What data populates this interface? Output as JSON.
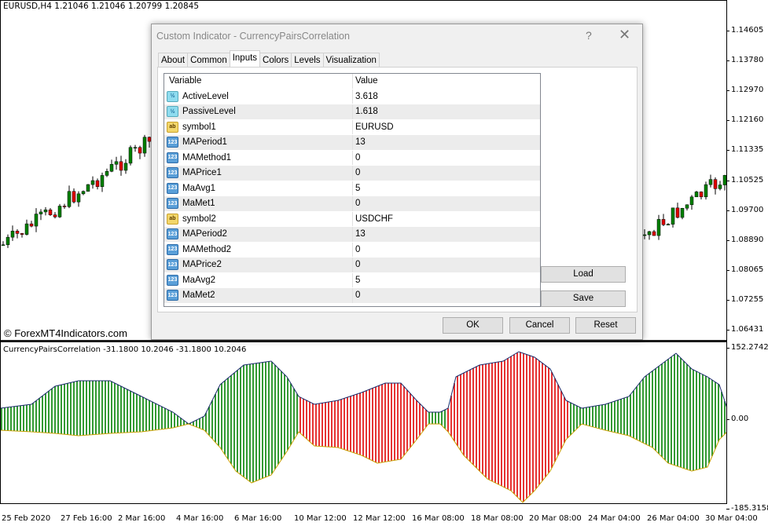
{
  "chart": {
    "symbol_info": "EURUSD,H4  1.21046 1.21046 1.20799 1.20845",
    "price_ticks": [
      "1.14605",
      "1.13780",
      "1.12970",
      "1.12160",
      "1.11335",
      "1.10525",
      "1.09700",
      "1.08890",
      "1.08065",
      "1.07255",
      "1.06431"
    ],
    "watermark": "© ForexMT4Indicators.com",
    "indicator_info": "CurrencyPairsCorrelation -31.1800 10.2046 -31.1800 10.2046",
    "indicator_ticks": [
      "152.2742",
      "0.00",
      "-185.3158"
    ],
    "time_ticks": [
      "25 Feb 2020",
      "27 Feb 16:00",
      "2 Mar 16:00",
      "4 Mar 16:00",
      "6 Mar 16:00",
      "10 Mar 12:00",
      "12 Mar 12:00",
      "16 Mar 08:00",
      "18 Mar 08:00",
      "20 Mar 08:00",
      "24 Mar 04:00",
      "26 Mar 04:00",
      "30 Mar 04:00"
    ],
    "colors": {
      "up": "#008000",
      "down": "#e00000"
    }
  },
  "dialog": {
    "title": "Custom Indicator - CurrencyPairsCorrelation",
    "help": "?",
    "close": "✕",
    "tabs": [
      "About",
      "Common",
      "Inputs",
      "Colors",
      "Levels",
      "Visualization"
    ],
    "active_tab": "Inputs",
    "headers": {
      "variable": "Variable",
      "value": "Value"
    },
    "rows": [
      {
        "type": "double",
        "icon": "½",
        "name": "ActiveLevel",
        "value": "3.618"
      },
      {
        "type": "double",
        "icon": "½",
        "name": "PassiveLevel",
        "value": "1.618"
      },
      {
        "type": "string",
        "icon": "ab",
        "name": "symbol1",
        "value": "EURUSD"
      },
      {
        "type": "int",
        "icon": "123",
        "name": "MAPeriod1",
        "value": "13"
      },
      {
        "type": "int",
        "icon": "123",
        "name": "MAMethod1",
        "value": "0"
      },
      {
        "type": "int",
        "icon": "123",
        "name": "MAPrice1",
        "value": "0"
      },
      {
        "type": "int",
        "icon": "123",
        "name": "MaAvg1",
        "value": "5"
      },
      {
        "type": "int",
        "icon": "123",
        "name": "MaMet1",
        "value": "0"
      },
      {
        "type": "string",
        "icon": "ab",
        "name": "symbol2",
        "value": "USDCHF"
      },
      {
        "type": "int",
        "icon": "123",
        "name": "MAPeriod2",
        "value": "13"
      },
      {
        "type": "int",
        "icon": "123",
        "name": "MAMethod2",
        "value": "0"
      },
      {
        "type": "int",
        "icon": "123",
        "name": "MAPrice2",
        "value": "0"
      },
      {
        "type": "int",
        "icon": "123",
        "name": "MaAvg2",
        "value": "5"
      },
      {
        "type": "int",
        "icon": "123",
        "name": "MaMet2",
        "value": "0"
      }
    ],
    "buttons": {
      "load": "Load",
      "save": "Save",
      "ok": "OK",
      "cancel": "Cancel",
      "reset": "Reset"
    }
  }
}
